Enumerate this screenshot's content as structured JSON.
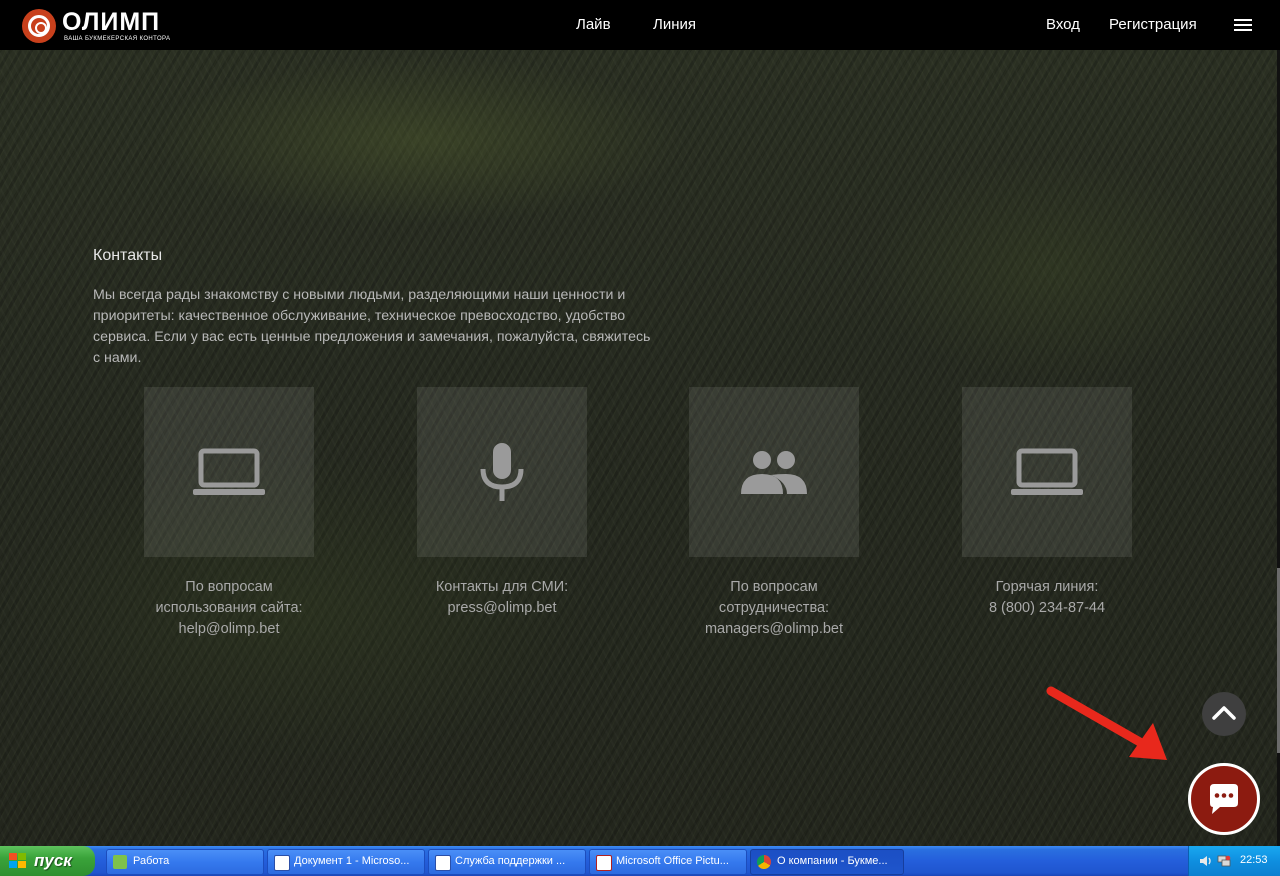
{
  "header": {
    "logo_name": "ОЛИМП",
    "logo_tagline": "ВАША БУКМЕКЕРСКАЯ КОНТОРА",
    "nav": [
      "Лайв",
      "Линия"
    ],
    "login": "Вход",
    "register": "Регистрация",
    "menu_icon": "hamburger-icon"
  },
  "contacts": {
    "title": "Контакты",
    "text": "Мы всегда рады знакомству с новыми людьми, разделяющими наши ценности и приоритеты: качественное обслуживание, техническое превосходство, удобство сервиса. Если у вас есть ценные предложения и замечания, пожалуйста, свяжитесь с нами.",
    "cards": [
      {
        "icon": "laptop-icon",
        "lines": [
          "По вопросам",
          "использования сайта:",
          "help@olimp.bet"
        ]
      },
      {
        "icon": "microphone-icon",
        "lines": [
          "Контакты для СМИ:",
          "press@olimp.bet"
        ]
      },
      {
        "icon": "people-icon",
        "lines": [
          "По вопросам",
          "сотрудничества:",
          "managers@olimp.bet"
        ]
      },
      {
        "icon": "laptop-icon",
        "lines": [
          "Горячая линия:",
          "8 (800) 234-87-44"
        ]
      }
    ]
  },
  "floating": {
    "scroll_top_icon": "chevron-up-icon",
    "chat_icon": "chat-bubble-icon",
    "chat_bg": "#8c1b10"
  },
  "taskbar": {
    "start": "пуск",
    "items": [
      {
        "label": "Работа",
        "icon": "folder-icon"
      },
      {
        "label": "Документ 1 - Microso...",
        "icon": "word-icon"
      },
      {
        "label": "Служба поддержки ...",
        "icon": "word-icon"
      },
      {
        "label": "Microsoft Office Pictu...",
        "icon": "picture-manager-icon"
      },
      {
        "label": "О компании - Букме...",
        "icon": "chrome-icon",
        "active": true
      }
    ],
    "clock": "22:53"
  },
  "colors": {
    "brand": "#c8401c",
    "taskbar": "#245edb",
    "start": "#3aa33a",
    "annotation_arrow": "#e8281c"
  }
}
